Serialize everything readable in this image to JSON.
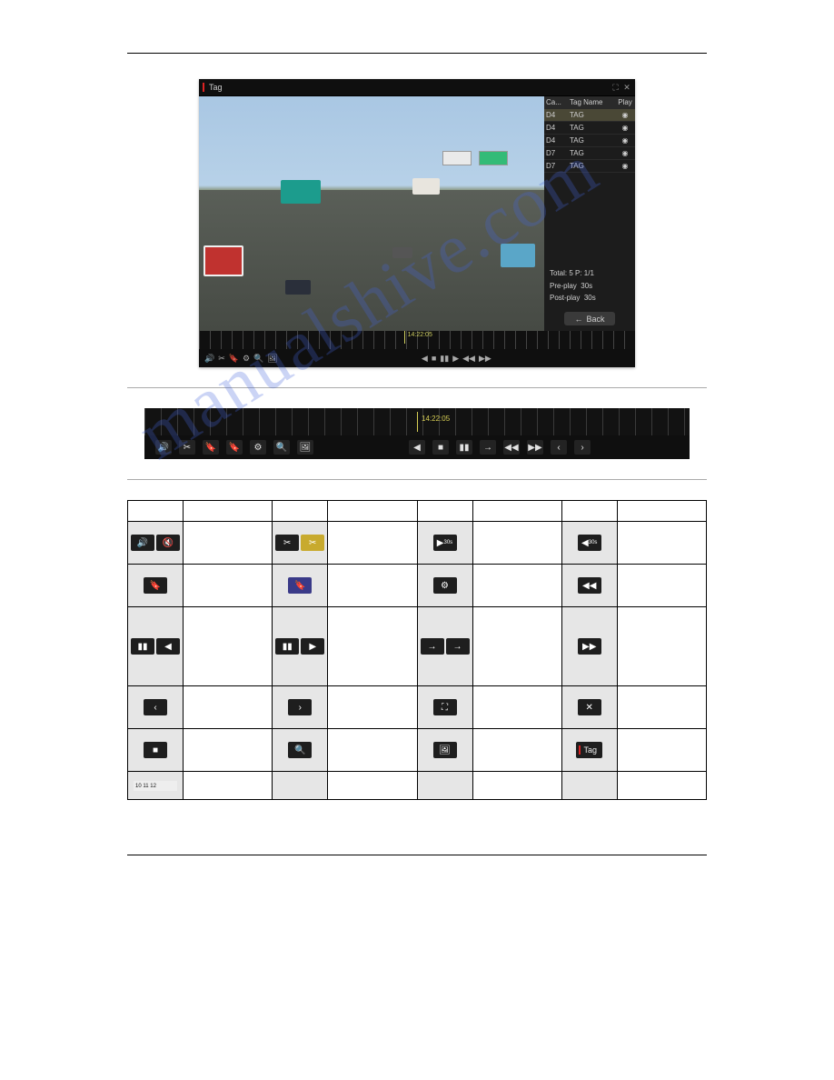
{
  "watermark": "manualshive.com",
  "player": {
    "title": "Tag",
    "timeline_marker": "14:22:05",
    "side": {
      "headers": {
        "cam": "Ca...",
        "name": "Tag Name",
        "play": "Play"
      },
      "rows": [
        {
          "cam": "D4",
          "name": "TAG"
        },
        {
          "cam": "D4",
          "name": "TAG"
        },
        {
          "cam": "D4",
          "name": "TAG"
        },
        {
          "cam": "D7",
          "name": "TAG"
        },
        {
          "cam": "D7",
          "name": "TAG"
        }
      ],
      "total": "Total: 5  P: 1/1",
      "preplay_label": "Pre-play",
      "preplay_value": "30s",
      "postplay_label": "Post-play",
      "postplay_value": "30s",
      "back": "Back"
    }
  },
  "toolbar_marker": "14:22:05",
  "icons": {
    "mute": "◀×",
    "clip": "✂",
    "fwd30": "▶30s",
    "back30": "◀30s",
    "tag_default": "🔖",
    "tag_custom": "🔖",
    "tag_mgmt": "⚙",
    "speed_down": "◀◀",
    "pause_rev": "▮◀",
    "pause_play": "▮▶",
    "single_fwd": "→",
    "speed_up": "▶▶",
    "prev": "‹",
    "next": "›",
    "fullscreen": "⛶",
    "exit": "✕",
    "stop": "■",
    "digital_zoom": "🔍",
    "capture": "🖼",
    "tag_label": "Tag",
    "progress": "10 11 12"
  }
}
